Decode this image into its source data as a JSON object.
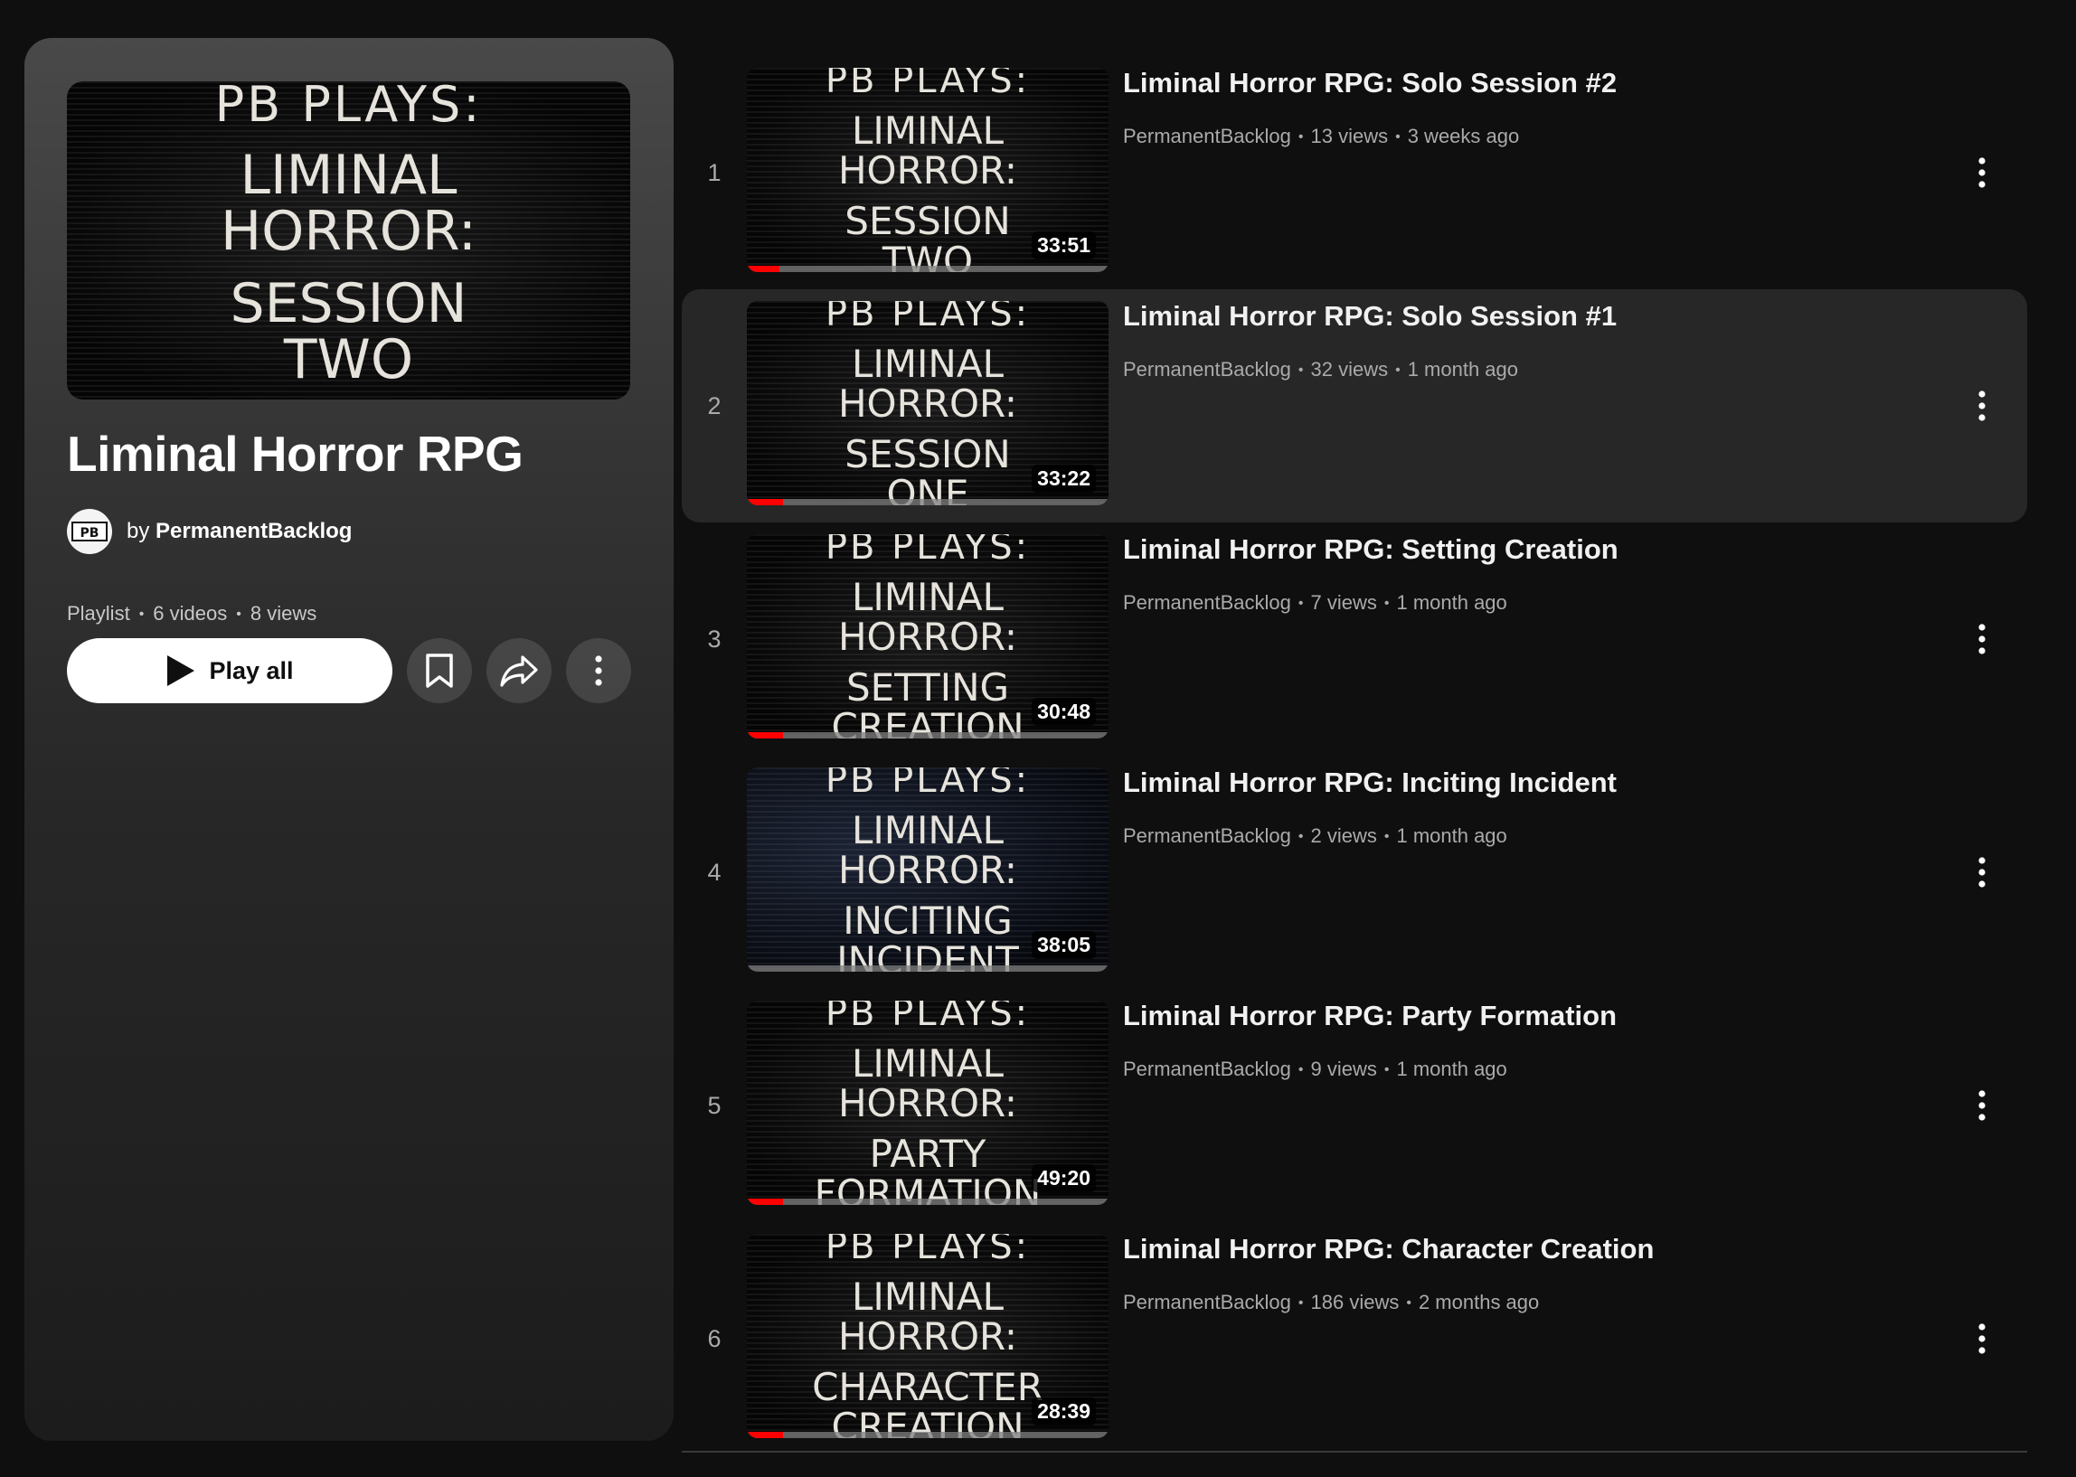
{
  "playlist": {
    "title": "Liminal Horror RPG",
    "owner_prefix": "by",
    "owner": "PermanentBacklog",
    "type": "Playlist",
    "video_count": "6 videos",
    "views": "8 views",
    "play_all_label": "Play all",
    "thumbnail_lines": [
      "PB PLAYS:",
      "LIMINAL",
      "HORROR:",
      "SESSION",
      "TWO"
    ]
  },
  "videos": [
    {
      "index": "1",
      "title": "Liminal Horror RPG: Solo Session #2",
      "channel": "PermanentBacklog",
      "views": "13 views",
      "age": "3 weeks ago",
      "duration": "33:51",
      "progress": 0.09,
      "active": false,
      "thumb": [
        "PB PLAYS:",
        "LIMINAL",
        "HORROR:",
        "SESSION",
        "TWO"
      ]
    },
    {
      "index": "2",
      "title": "Liminal Horror RPG: Solo Session #1",
      "channel": "PermanentBacklog",
      "views": "32 views",
      "age": "1 month ago",
      "duration": "33:22",
      "progress": 0.1,
      "active": true,
      "thumb": [
        "PB PLAYS:",
        "LIMINAL",
        "HORROR:",
        "SESSION",
        "ONE"
      ]
    },
    {
      "index": "3",
      "title": "Liminal Horror RPG: Setting Creation",
      "channel": "PermanentBacklog",
      "views": "7 views",
      "age": "1 month ago",
      "duration": "30:48",
      "progress": 0.1,
      "active": false,
      "thumb": [
        "PB PLAYS:",
        "LIMINAL",
        "HORROR:",
        "SETTING",
        "CREATION"
      ]
    },
    {
      "index": "4",
      "title": "Liminal Horror RPG: Inciting Incident",
      "channel": "PermanentBacklog",
      "views": "2 views",
      "age": "1 month ago",
      "duration": "38:05",
      "progress": 0.0,
      "active": false,
      "thumb": [
        "PB PLAYS:",
        "LIMINAL",
        "HORROR:",
        "INCITING",
        "INCIDENT"
      ]
    },
    {
      "index": "5",
      "title": "Liminal Horror RPG: Party Formation",
      "channel": "PermanentBacklog",
      "views": "9 views",
      "age": "1 month ago",
      "duration": "49:20",
      "progress": 0.1,
      "active": false,
      "thumb": [
        "PB PLAYS:",
        "LIMINAL",
        "HORROR:",
        "PARTY",
        "FORMATION"
      ]
    },
    {
      "index": "6",
      "title": "Liminal Horror RPG: Character Creation",
      "channel": "PermanentBacklog",
      "views": "186 views",
      "age": "2 months ago",
      "duration": "28:39",
      "progress": 0.1,
      "active": false,
      "thumb": [
        "PB PLAYS:",
        "LIMINAL",
        "HORROR:",
        "CHARACTER",
        "CREATION"
      ]
    }
  ],
  "colors": {
    "accent": "#ff0000",
    "background": "#0f0f0f",
    "active_row": "#272727"
  },
  "icons": {
    "play": "play-icon",
    "save": "bookmark-icon",
    "share": "share-icon",
    "more": "more-vert-icon"
  }
}
